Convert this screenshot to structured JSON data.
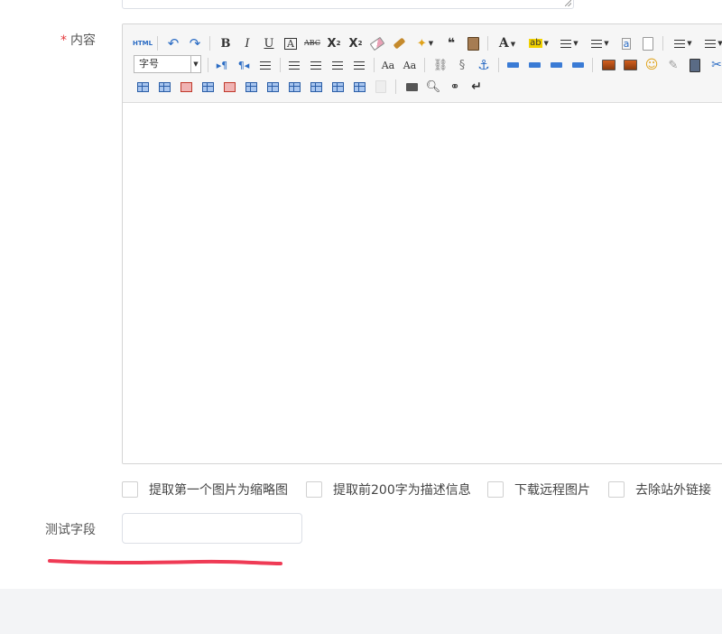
{
  "content_field": {
    "label": "内容",
    "required_mark": "*"
  },
  "toolbar": {
    "html_label": "HTML",
    "bold": "B",
    "italic": "I",
    "underline": "U",
    "font_border": "A",
    "strikethrough": "ABC",
    "superscript_base": "X",
    "superscript_mark": "2",
    "subscript_base": "X",
    "subscript_mark": "2",
    "quote": "❝",
    "font_color": "A",
    "backcolor": "ab",
    "fontsize_value": "字号",
    "paragraph_ltr": "▸¶",
    "paragraph_rtl": "¶◂",
    "uppercase": "Aa",
    "lowercase": "Aa",
    "return": "↵"
  },
  "options": [
    {
      "label": "提取第一个图片为缩略图",
      "checked": false
    },
    {
      "label": "提取前200字为描述信息",
      "checked": false
    },
    {
      "label": "下载远程图片",
      "checked": false
    },
    {
      "label": "去除站外链接",
      "checked": false
    }
  ],
  "test_field": {
    "label": "测试字段",
    "value": ""
  },
  "colors": {
    "required": "#e4393c",
    "annotation": "#ef3b55",
    "toolbar_blue": "#2b6cc4"
  }
}
